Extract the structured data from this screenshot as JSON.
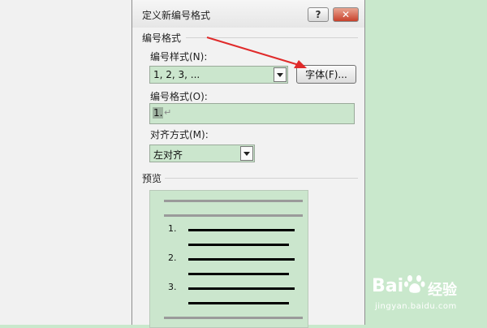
{
  "dialog": {
    "title": "定义新编号格式",
    "help_label": "?",
    "close_label": "✕",
    "section_numbering": "编号格式",
    "style_label": "编号样式(N):",
    "style_value": "1, 2, 3, ...",
    "font_button": "字体(F)...",
    "format_label": "编号格式(O):",
    "format_value": "1.",
    "format_para_mark": "↵",
    "align_label": "对齐方式(M):",
    "align_value": "左对齐",
    "section_preview": "预览",
    "preview_numbers": [
      "1.",
      "2.",
      "3."
    ]
  },
  "watermark": {
    "logo_text": "Bai",
    "brand_text": "经验",
    "url": "jingyan.baidu.com"
  },
  "colors": {
    "annotation_arrow": "#e02b2b",
    "field_bg": "#cbe6cd",
    "page_bg": "#c9e8cc"
  }
}
